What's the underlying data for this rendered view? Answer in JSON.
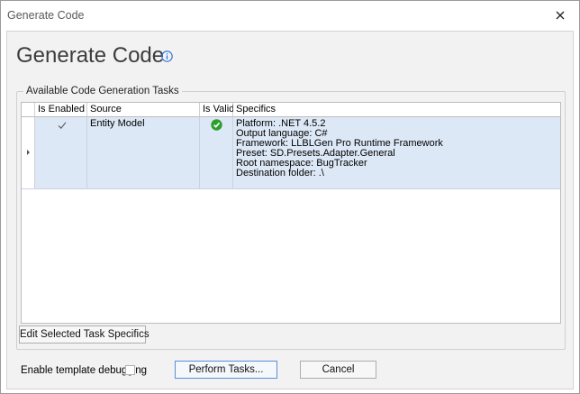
{
  "window": {
    "title": "Generate Code",
    "close_glyph": "close-icon"
  },
  "main": {
    "heading": "Generate Code",
    "info_icon": "info-icon"
  },
  "tasks_group": {
    "title": "Available Code Generation Tasks",
    "columns": {
      "is_enabled": "Is Enabled",
      "source": "Source",
      "is_valid": "Is Valid",
      "specifics": "Specifics"
    },
    "rows": [
      {
        "is_enabled": true,
        "source": "Entity Model",
        "is_valid": true,
        "specifics": [
          "Platform: .NET 4.5.2",
          "Output language: C#",
          "Framework: LLBLGen Pro Runtime Framework",
          "Preset: SD.Presets.Adapter.General",
          "Root namespace: BugTracker",
          "Destination folder: .\\"
        ]
      }
    ]
  },
  "buttons": {
    "edit_specifics": "Edit Selected Task Specifics",
    "perform_tasks": "Perform Tasks...",
    "cancel": "Cancel"
  },
  "options": {
    "template_debugging_label": "Enable template debugging",
    "template_debugging_checked": false
  },
  "colors": {
    "selected_row": "#dde8f6",
    "valid_green": "#2e9e2e",
    "info_blue": "#2b6fd1",
    "primary_border": "#5a8fd6"
  }
}
